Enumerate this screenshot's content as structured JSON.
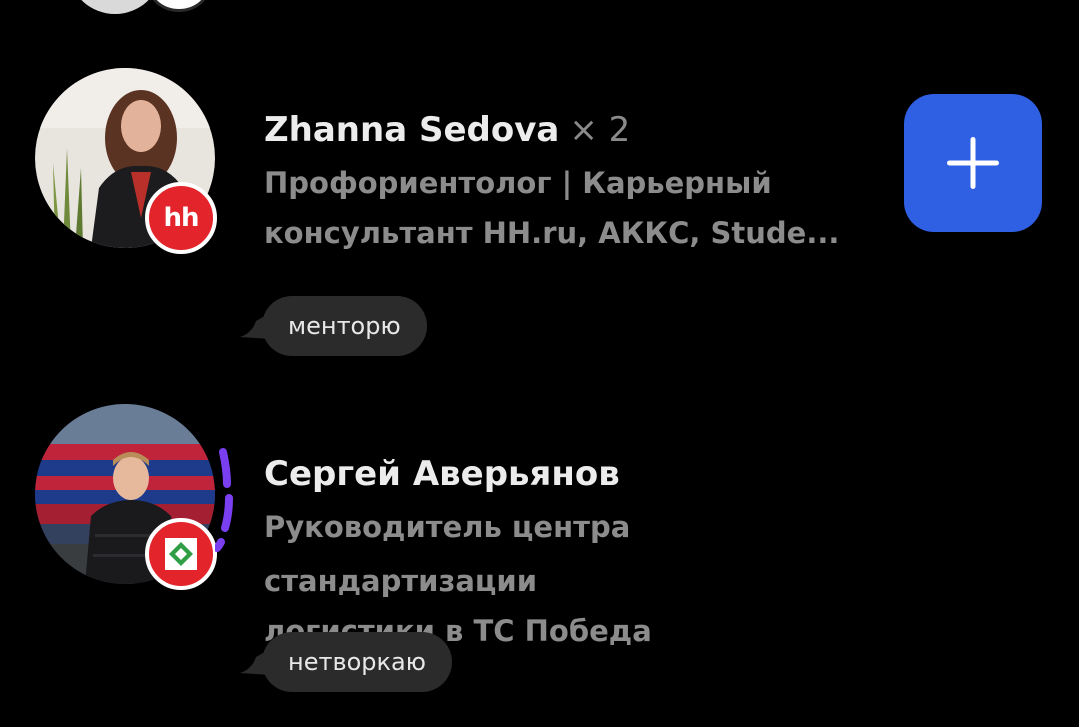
{
  "cards": [
    {
      "name": "Zhanna Sedova",
      "multiplier": "× 2",
      "headline_line1": "Профориентолог | Карьерный",
      "headline_line2": "консультант HH.ru, АККС, Stude...",
      "company_badge": "hh",
      "tag": "менторю",
      "has_add_button": true,
      "badge_color": "#e3242b"
    },
    {
      "name": "Сергей Аверьянов",
      "headline_line1": "Руководитель центра стандартизации",
      "headline_line2": "логистики в ТС Победа",
      "company_badge": "pobeda-logo",
      "tag": "нетворкаю",
      "has_story_ring": true,
      "story_ring_color": "#7b3ff2",
      "badge_color": "#e3242b"
    }
  ],
  "colors": {
    "background": "#000000",
    "accent_button": "#2f5fe3",
    "name_text": "#ececec",
    "secondary_text": "#8c8c8c",
    "tag_background": "#2b2b2b"
  },
  "icons": {
    "add": "plus-icon"
  }
}
